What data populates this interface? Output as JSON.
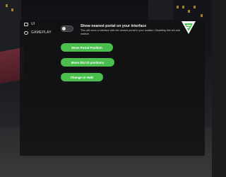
{
  "sidebar": {
    "items": [
      {
        "label": "UI",
        "icon": "monitor-icon"
      },
      {
        "label": "GAMEPLAY",
        "icon": "cloud-icon"
      }
    ]
  },
  "option": {
    "title": "Show nearest portal on your interface",
    "description": "This will show a interface with the closest portal to your location. Disabling this will add realism.",
    "enabled": false
  },
  "buttons": {
    "move_portal": "Move Portal Position",
    "move_ui": "Move DIU UI positions",
    "change_hud": "Change UI HUD"
  },
  "colors": {
    "accent": "#4bbf4e",
    "panel": "#121214"
  }
}
